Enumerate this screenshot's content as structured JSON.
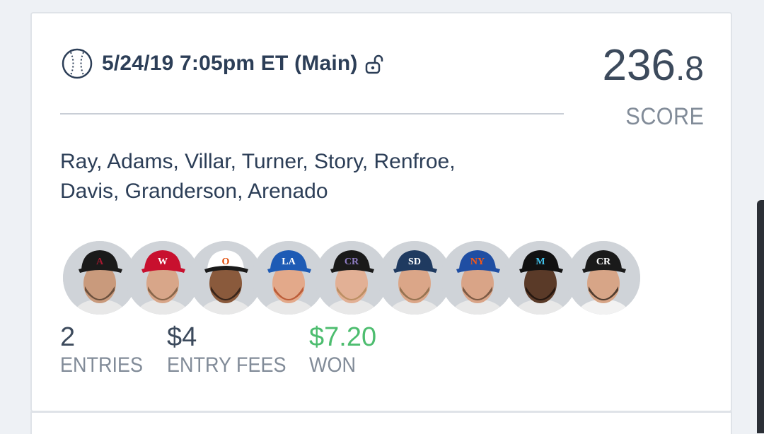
{
  "contest": {
    "title": "5/24/19 7:05pm ET (Main)",
    "icon": "baseball-icon",
    "status_icon": "unlock-icon"
  },
  "score": {
    "whole": "236",
    "decimal": ".8",
    "label": "SCORE"
  },
  "lineup": {
    "players_line1": "Ray, Adams, Villar, Turner, Story, Renfroe,",
    "players_line2": "Davis, Granderson, Arenado",
    "avatars": [
      {
        "team": "Diamondbacks",
        "cap": "#1a1a1a",
        "logo": "A",
        "logo_color": "#a71930"
      },
      {
        "team": "Nationals",
        "cap": "#c8102e",
        "logo": "W",
        "logo_color": "#ffffff"
      },
      {
        "team": "Orioles",
        "cap": "#ffffff",
        "logo": "O",
        "logo_color": "#df4601"
      },
      {
        "team": "Dodgers",
        "cap": "#1e5bb5",
        "logo": "LA",
        "logo_color": "#ffffff"
      },
      {
        "team": "Rockies",
        "cap": "#1a1a1a",
        "logo": "CR",
        "logo_color": "#8e7cc3"
      },
      {
        "team": "Padres",
        "cap": "#1f3a60",
        "logo": "SD",
        "logo_color": "#ffffff"
      },
      {
        "team": "Mets",
        "cap": "#1f4ea3",
        "logo": "NY",
        "logo_color": "#ff5910"
      },
      {
        "team": "Marlins",
        "cap": "#111111",
        "logo": "M",
        "logo_color": "#41c0e8"
      },
      {
        "team": "Rockies",
        "cap": "#1a1a1a",
        "logo": "CR",
        "logo_color": "#ffffff"
      }
    ]
  },
  "stats": {
    "entries_value": "2",
    "entries_label": "ENTRIES",
    "fees_value": "$4",
    "fees_label": "ENTRY FEES",
    "won_value": "$7.20",
    "won_label": "WON"
  },
  "colors": {
    "title": "#2c3e57",
    "won": "#4dbd6f",
    "muted": "#818b98"
  }
}
